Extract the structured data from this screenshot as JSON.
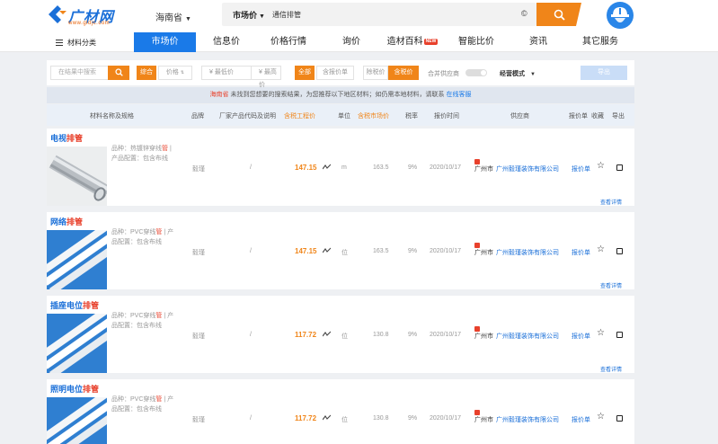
{
  "header": {
    "logo_text": "广材网",
    "logo_url": "www.gldjc.com",
    "region": "海南省",
    "search_type": "市场价",
    "search_value": "通信排管"
  },
  "nav": {
    "category": "材料分类",
    "items": [
      {
        "label": "市场价",
        "active": true
      },
      {
        "label": "信息价"
      },
      {
        "label": "价格行情"
      },
      {
        "label": "询价"
      },
      {
        "label": "造材百科",
        "badge": "NEW"
      },
      {
        "label": "智能比价"
      },
      {
        "label": "资讯"
      },
      {
        "label": "其它服务"
      }
    ]
  },
  "filter": {
    "search_placeholder": "在结果中搜索",
    "sort_combined": "综合",
    "sort_price": "价格",
    "min_price_placeholder": "¥ 最低价",
    "dash": "—",
    "max_price_placeholder": "¥ 最高价",
    "all_label": "全部",
    "quoted_label": "含报价单",
    "tax_excluded": "除税价",
    "tax_included": "含税价",
    "merge_supplier": "合并供应商",
    "mode": "经营模式",
    "export": "导出"
  },
  "notice": {
    "region": "海南省",
    "text": "未找到您想要的搜索结果，为您推荐以下地区材料；如仍需本地材料，请联系",
    "link": "在线客服"
  },
  "table_header": {
    "name": "材料名称及规格",
    "brand": "品牌",
    "code": "厂家产品代码及说明",
    "eng_price": "含税工程价",
    "unit": "单位",
    "market_price": "含税市场价",
    "tax": "税率",
    "date": "报价时间",
    "supplier": "供应商",
    "quote": "报价单",
    "favorite": "收藏",
    "export": "导出"
  },
  "products": [
    {
      "title_pre": "电视",
      "title_kw": "排管",
      "spec_variety_pre": "品种：热镀锌穿线",
      "spec_variety_kw": "管",
      "spec_config": "| 产品配置：包含布线",
      "brand": "毅瑾",
      "code": "/",
      "eng_price": "147.15",
      "unit": "m",
      "market_price": "163.5",
      "tax": "9%",
      "date": "2020/10/17",
      "city": "广州市",
      "supplier": "广州毅瑾装饰有限公司",
      "quote": "报价单",
      "detail": "查看详情"
    },
    {
      "title_pre": "网络",
      "title_kw": "排管",
      "spec_variety_pre": "品种：PVC穿线",
      "spec_variety_kw": "管",
      "spec_config": "| 产品配置：包含布线",
      "brand": "毅瑾",
      "code": "/",
      "eng_price": "147.15",
      "unit": "位",
      "market_price": "163.5",
      "tax": "9%",
      "date": "2020/10/17",
      "city": "广州市",
      "supplier": "广州毅瑾装饰有限公司",
      "quote": "报价单",
      "detail": "查看详情"
    },
    {
      "title_pre": "插座电位",
      "title_kw": "排管",
      "spec_variety_pre": "品种：PVC穿线",
      "spec_variety_kw": "管",
      "spec_config": "| 产品配置：包含布线",
      "brand": "毅瑾",
      "code": "/",
      "eng_price": "117.72",
      "unit": "位",
      "market_price": "130.8",
      "tax": "9%",
      "date": "2020/10/17",
      "city": "广州市",
      "supplier": "广州毅瑾装饰有限公司",
      "quote": "报价单",
      "detail": "查看详情"
    },
    {
      "title_pre": "照明电位",
      "title_kw": "排管",
      "spec_variety_pre": "品种：PVC穿线",
      "spec_variety_kw": "管",
      "spec_config": "| 产品配置：包含布线",
      "brand": "毅瑾",
      "code": "/",
      "eng_price": "117.72",
      "unit": "位",
      "market_price": "130.8",
      "tax": "9%",
      "date": "2020/10/17",
      "city": "广州市",
      "supplier": "广州毅瑾装饰有限公司",
      "quote": "报价单",
      "detail": "查看详情"
    }
  ],
  "colors": {
    "brand_blue": "#1a7ae8",
    "accent_orange": "#f08519",
    "keyword_red": "#e8412c"
  }
}
